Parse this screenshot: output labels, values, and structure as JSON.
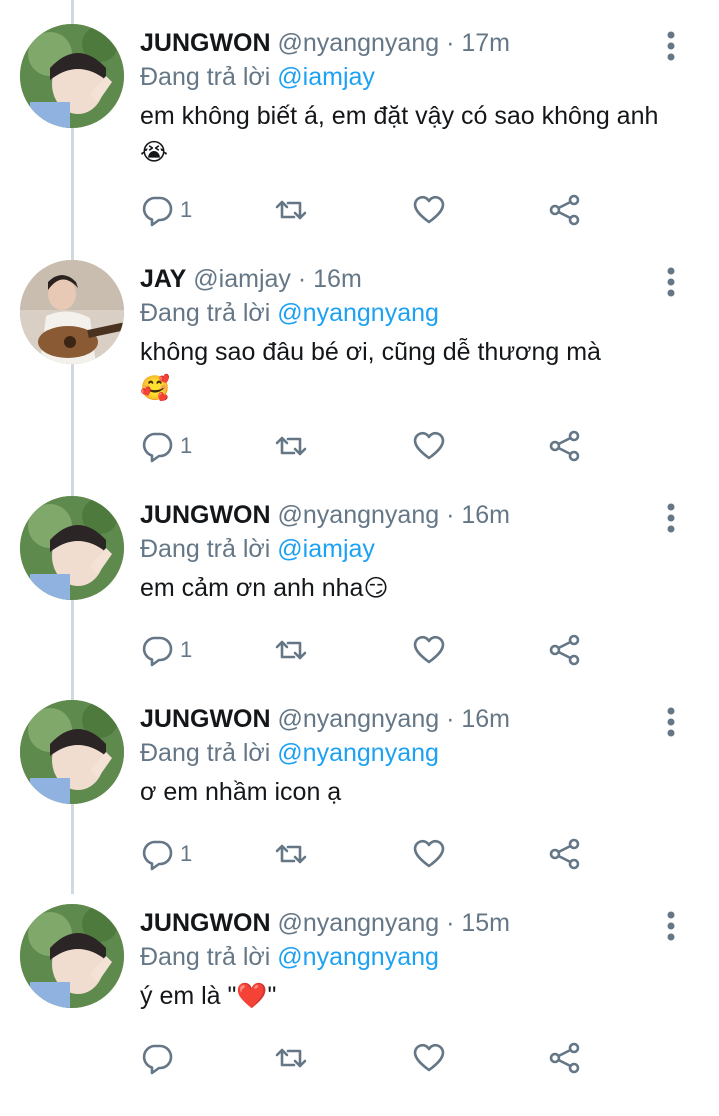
{
  "reply_prefix": "Đang trả lời",
  "tweets": [
    {
      "name": "JUNGWON",
      "handle": "@nyangnyang",
      "separator": "·",
      "time": "17m",
      "reply_to": "@iamjay",
      "text": "em không biết á, em đặt vậy có sao không anh",
      "emoji": "😭",
      "reply_count": "1",
      "avatar": "jungwon-avatar"
    },
    {
      "name": "JAY",
      "handle": "@iamjay",
      "separator": "·",
      "time": "16m",
      "reply_to": "@nyangnyang",
      "text": "không sao đâu bé ơi, cũng dễ thương mà",
      "emoji": "🥰",
      "reply_count": "1",
      "avatar": "jay-avatar"
    },
    {
      "name": "JUNGWON",
      "handle": "@nyangnyang",
      "separator": "·",
      "time": "16m",
      "reply_to": "@iamjay",
      "text": "em cảm ơn anh nha",
      "emoji": "😏",
      "reply_count": "1",
      "avatar": "jungwon-avatar"
    },
    {
      "name": "JUNGWON",
      "handle": "@nyangnyang",
      "separator": "·",
      "time": "16m",
      "reply_to": "@nyangnyang",
      "text": "ơ em nhầm icon ạ",
      "emoji": "",
      "reply_count": "1",
      "avatar": "jungwon-avatar"
    },
    {
      "name": "JUNGWON",
      "handle": "@nyangnyang",
      "separator": "·",
      "time": "15m",
      "reply_to": "@nyangnyang",
      "text": "ý em là \"❤️\"",
      "emoji": "",
      "reply_count": "",
      "avatar": "jungwon-avatar"
    }
  ],
  "colors": {
    "text": "#14171a",
    "secondary": "#657786",
    "mention": "#1da1f2",
    "thread_line": "#cfd9de"
  },
  "icons": [
    "reply-icon",
    "retweet-icon",
    "like-icon",
    "share-icon",
    "more-options-icon"
  ]
}
